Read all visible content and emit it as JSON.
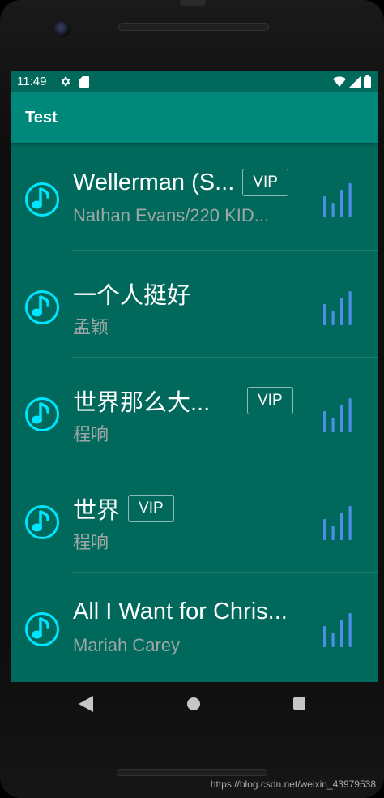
{
  "status_bar": {
    "time": "11:49",
    "icons": [
      "gear-icon",
      "sd-card-icon",
      "wifi-icon",
      "signal-icon",
      "battery-icon"
    ]
  },
  "app_bar": {
    "title": "Test"
  },
  "songs": [
    {
      "title": "Wellerman (S...",
      "artist": "Nathan Evans/220 KID...",
      "vip": "VIP"
    },
    {
      "title": "一个人挺好",
      "artist": "孟颖",
      "vip": ""
    },
    {
      "title": "世界那么大...",
      "artist": "程响",
      "vip": "VIP"
    },
    {
      "title": "世界",
      "artist": "程响",
      "vip": "VIP"
    },
    {
      "title": "All I Want for Chris...",
      "artist": "Mariah Carey",
      "vip": ""
    }
  ],
  "nav_bar": {
    "icons": [
      "back-icon",
      "home-icon",
      "recents-icon"
    ]
  },
  "watermark": "https://blog.csdn.net/weixin_43979538",
  "colors": {
    "status_bar": "#00695c",
    "app_bar": "#00897b",
    "list_background": "#00695c",
    "note_icon": "#00e5ff",
    "equalizer_icon": "#4e8fe6"
  }
}
